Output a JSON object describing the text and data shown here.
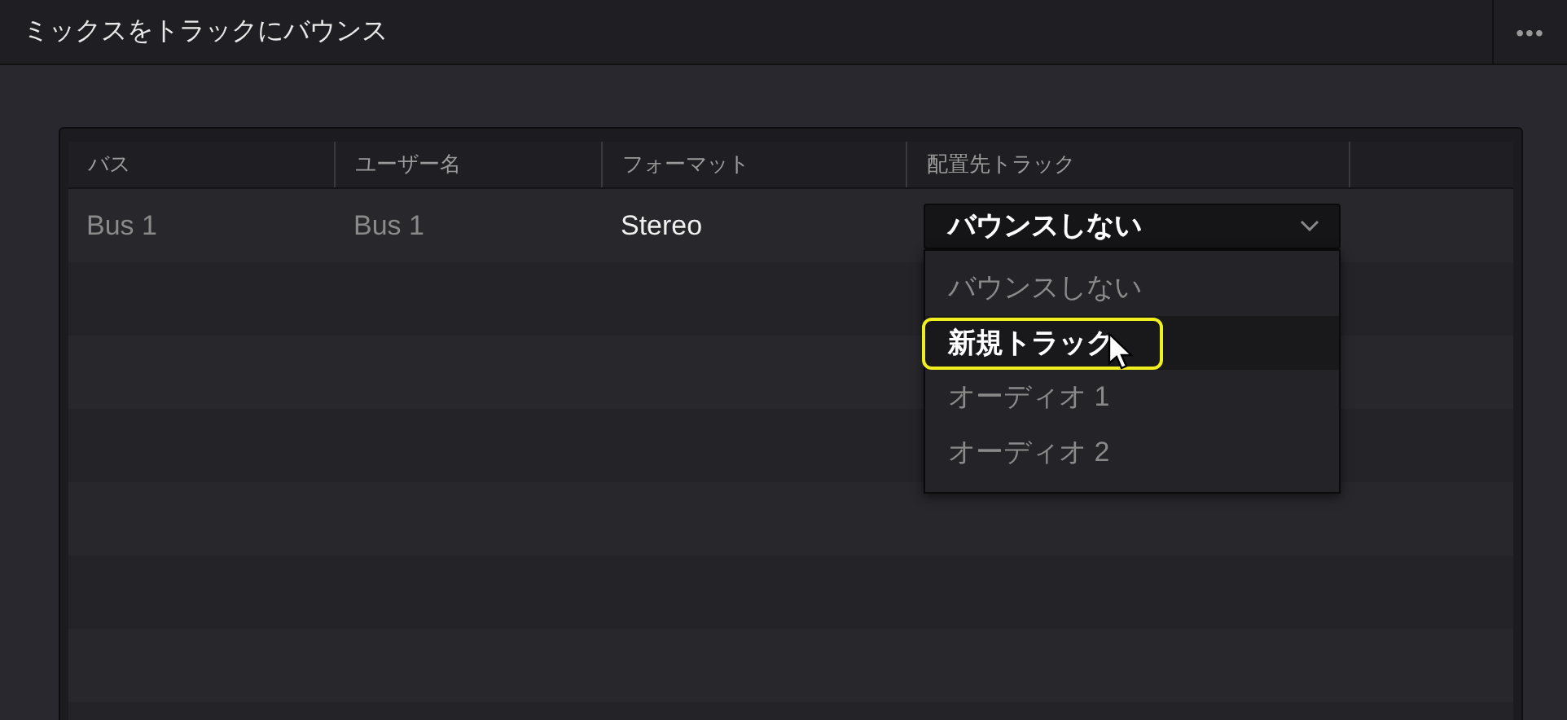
{
  "window": {
    "title": "ミックスをトラックにバウンス",
    "more_button": "•••"
  },
  "table": {
    "columns": [
      "バス",
      "ユーザー名",
      "フォーマット",
      "配置先トラック"
    ],
    "rows": [
      {
        "bus": "Bus 1",
        "user_name": "Bus 1",
        "format": "Stereo",
        "destination": "バウンスしない"
      }
    ]
  },
  "dropdown_menu": {
    "options": [
      {
        "label": "バウンスしない",
        "highlighted": false
      },
      {
        "label": "新規トラック",
        "highlighted": true
      },
      {
        "label": "オーディオ 1",
        "highlighted": false
      },
      {
        "label": "オーディオ 2",
        "highlighted": false
      }
    ]
  }
}
